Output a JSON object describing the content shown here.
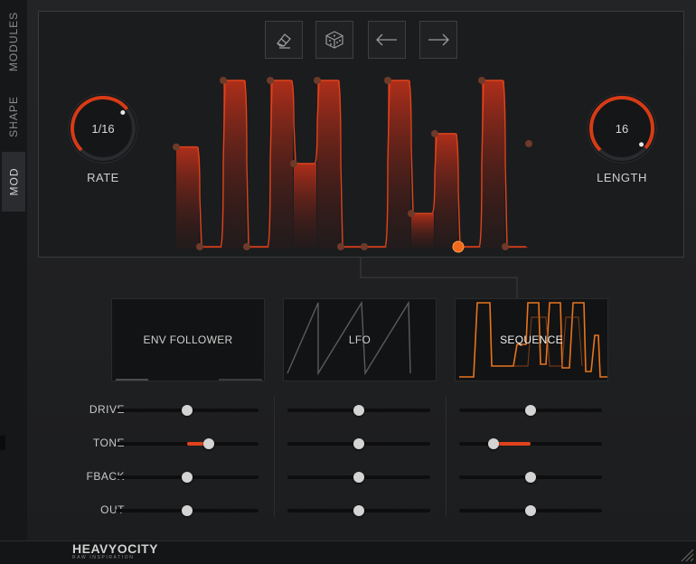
{
  "tabs": [
    {
      "label": "MODULES",
      "active": false
    },
    {
      "label": "SHAPE",
      "active": false
    },
    {
      "label": "MOD",
      "active": true
    }
  ],
  "toolbar": [
    {
      "icon": "eraser-icon"
    },
    {
      "icon": "dice-icon"
    },
    {
      "icon": "arrow-left-icon"
    },
    {
      "icon": "arrow-right-icon"
    }
  ],
  "rate": {
    "label": "RATE",
    "value": "1/16"
  },
  "length": {
    "label": "LENGTH",
    "value": "16"
  },
  "sequence_steps": {
    "count": 16,
    "active_step": 12,
    "values": [
      0.6,
      0.0,
      1.0,
      0.0,
      1.0,
      0.5,
      1.0,
      0.0,
      0.0,
      1.0,
      0.2,
      0.68,
      0.0,
      1.0,
      0.0,
      0.62
    ]
  },
  "modules": [
    {
      "label": "ENV FOLLOWER",
      "active": false
    },
    {
      "label": "LFO",
      "active": false
    },
    {
      "label": "SEQUENCE",
      "active": true
    }
  ],
  "params": [
    "DRIVE",
    "TONE",
    "FBACK",
    "OUT"
  ],
  "sliders": [
    [
      0.5,
      0.5,
      0.5
    ],
    [
      0.65,
      0.5,
      0.24
    ],
    [
      0.5,
      0.5,
      0.5
    ],
    [
      0.5,
      0.5,
      0.5
    ]
  ],
  "brand": {
    "name": "HEAVYOCITY",
    "tagline": "RAW INSPIRATION"
  },
  "colors": {
    "accent": "#e0431b",
    "active_step": "#f06a1c",
    "sequence_glow": "#e8741e"
  }
}
